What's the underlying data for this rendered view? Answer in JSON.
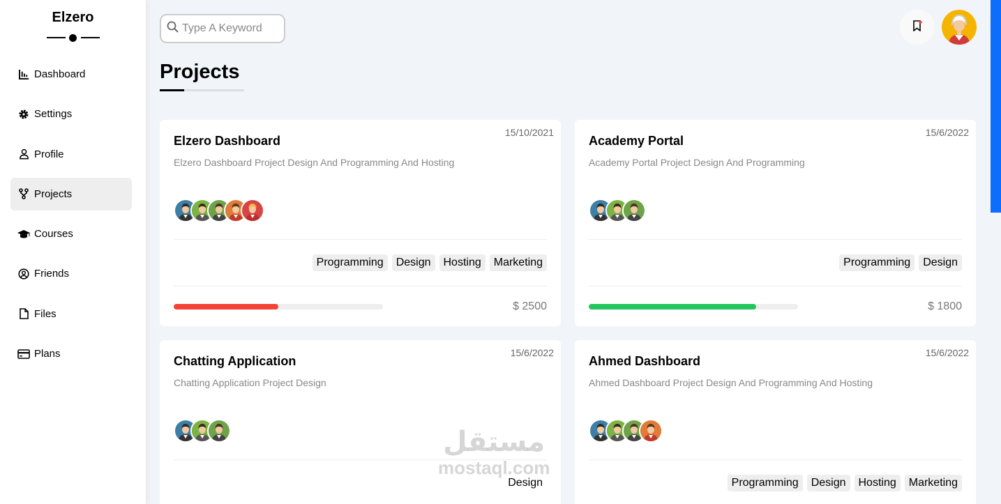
{
  "brand": "Elzero",
  "nav": [
    {
      "label": "Dashboard",
      "icon": "chart-bar-icon"
    },
    {
      "label": "Settings",
      "icon": "gear-icon"
    },
    {
      "label": "Profile",
      "icon": "user-icon"
    },
    {
      "label": "Projects",
      "icon": "diagram-project-icon",
      "active": true
    },
    {
      "label": "Courses",
      "icon": "graduation-cap-icon"
    },
    {
      "label": "Friends",
      "icon": "circle-user-icon"
    },
    {
      "label": "Files",
      "icon": "file-icon"
    },
    {
      "label": "Plans",
      "icon": "credit-card-icon"
    }
  ],
  "search": {
    "placeholder": "Type A Keyword"
  },
  "page_title": "Projects",
  "projects": [
    {
      "date": "15/10/2021",
      "name": "Elzero Dashboard",
      "desc": "Elzero Dashboard Project Design And Programming And Hosting",
      "team_count": 5,
      "tags": [
        "Programming",
        "Design",
        "Hosting",
        "Marketing"
      ],
      "progress": 0.5,
      "progress_color": "#f44336",
      "price": "$ 2500"
    },
    {
      "date": "15/6/2022",
      "name": "Academy Portal",
      "desc": "Academy Portal Project Design And Programming",
      "team_count": 3,
      "tags": [
        "Programming",
        "Design"
      ],
      "progress": 0.8,
      "progress_color": "#22c55e",
      "price": "$ 1800"
    },
    {
      "date": "15/6/2022",
      "name": "Chatting Application",
      "desc": "Chatting Application Project Design",
      "team_count": 3,
      "tags": [
        "Design"
      ]
    },
    {
      "date": "15/6/2022",
      "name": "Ahmed Dashboard",
      "desc": "Ahmed Dashboard Project Design And Programming And Hosting",
      "team_count": 4,
      "tags": [
        "Programming",
        "Design",
        "Hosting",
        "Marketing"
      ]
    }
  ],
  "watermark": {
    "ar": "مستقل",
    "en": "mostaql.com"
  },
  "colors": {
    "accent": "#0d6efd",
    "avatar_bg": "#f5b400"
  }
}
